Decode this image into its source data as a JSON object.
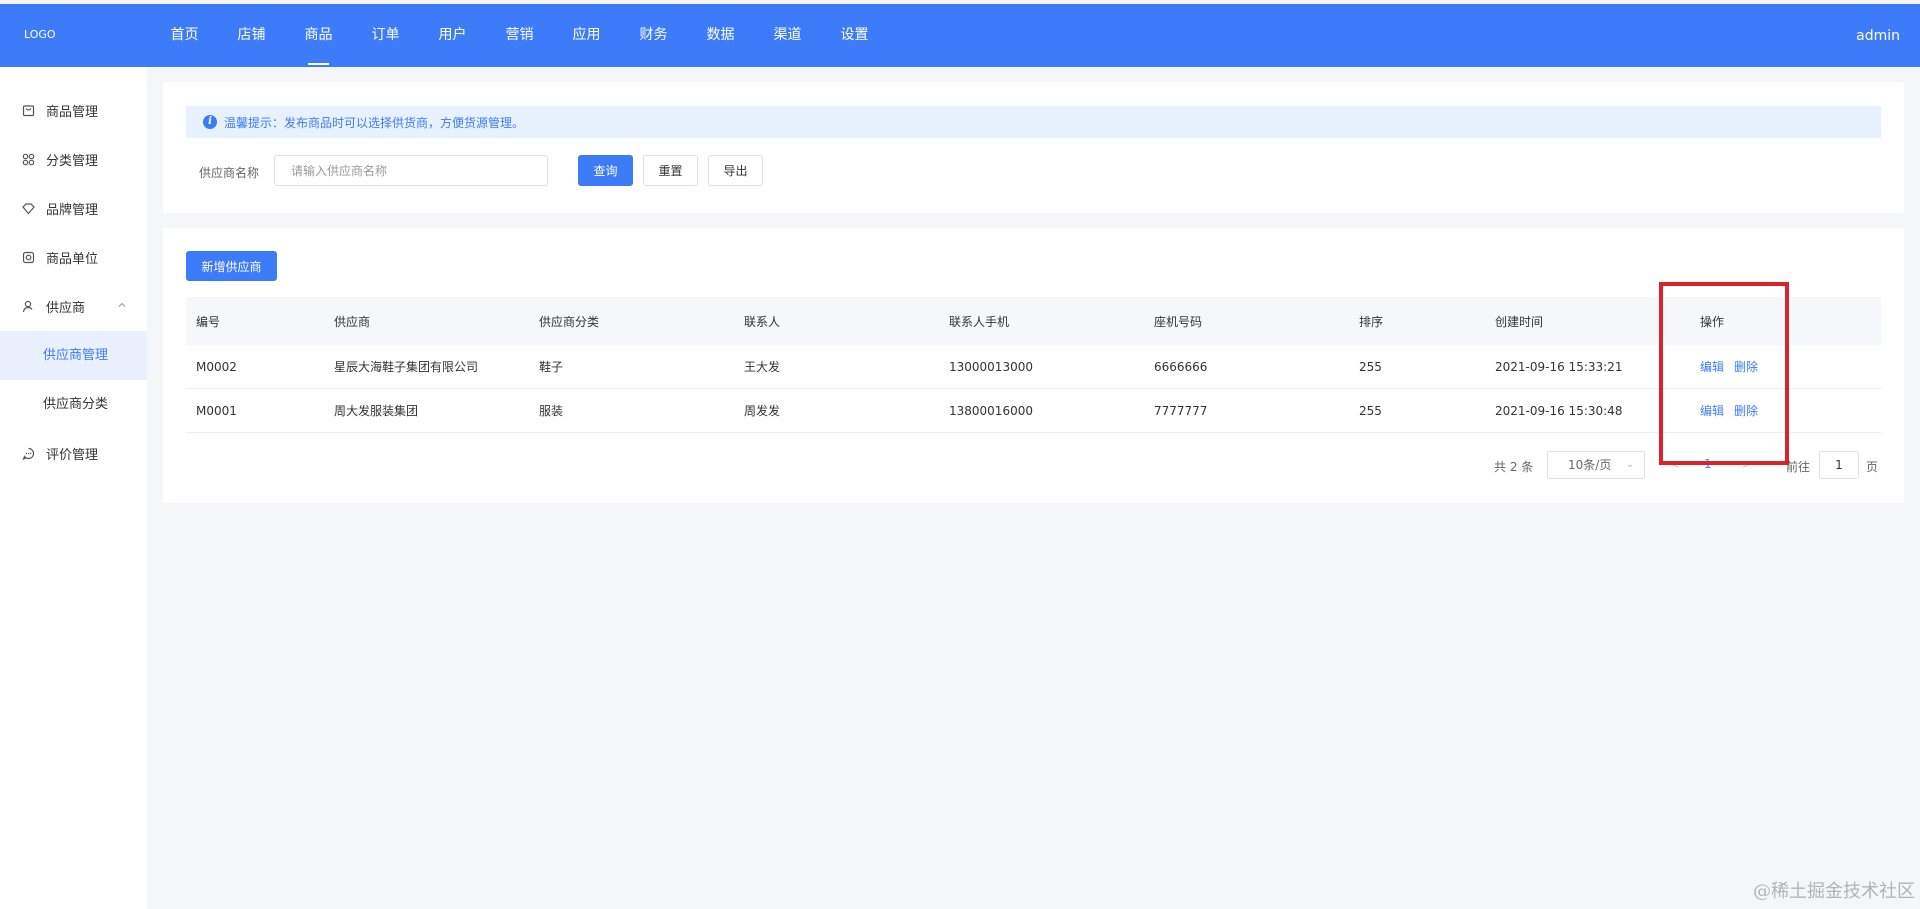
{
  "header": {
    "logo": "LOGO",
    "nav": [
      "首页",
      "店铺",
      "商品",
      "订单",
      "用户",
      "营销",
      "应用",
      "财务",
      "数据",
      "渠道",
      "设置"
    ],
    "active_nav": "商品",
    "user": "admin"
  },
  "sidebar": {
    "items": [
      {
        "label": "商品管理",
        "icon": "bag-icon"
      },
      {
        "label": "分类管理",
        "icon": "grid-icon"
      },
      {
        "label": "品牌管理",
        "icon": "diamond-icon"
      },
      {
        "label": "商品单位",
        "icon": "circle-icon"
      },
      {
        "label": "供应商",
        "icon": "user-icon"
      },
      {
        "label": "评价管理",
        "icon": "chat-icon"
      }
    ],
    "supplier_sub": [
      "供应商管理",
      "供应商分类"
    ],
    "active_sub": "供应商管理"
  },
  "filter": {
    "tip": "温馨提示：发布商品时可以选择供货商，方便货源管理。",
    "label": "供应商名称",
    "placeholder": "请输入供应商名称",
    "query": "查询",
    "reset": "重置",
    "export": "导出"
  },
  "list": {
    "add_button": "新增供应商",
    "columns": [
      "编号",
      "供应商",
      "供应商分类",
      "联系人",
      "联系人手机",
      "座机号码",
      "排序",
      "创建时间",
      "操作"
    ],
    "rows": [
      {
        "id": "M0002",
        "name": "星辰大海鞋子集团有限公司",
        "category": "鞋子",
        "contact": "王大发",
        "mobile": "13000013000",
        "phone": "6666666",
        "sort": "255",
        "created": "2021-09-16 15:33:21"
      },
      {
        "id": "M0001",
        "name": "周大发服装集团",
        "category": "服装",
        "contact": "周发发",
        "mobile": "13800016000",
        "phone": "7777777",
        "sort": "255",
        "created": "2021-09-16 15:30:48"
      }
    ],
    "edit": "编辑",
    "delete": "删除"
  },
  "pagination": {
    "total": "共 2 条",
    "page_size": "10条/页",
    "current": "1",
    "goto": "前往",
    "page_value": "1",
    "page_suffix": "页"
  },
  "watermark": "@稀土掘金技术社区",
  "colors": {
    "primary": "#3e7bf9",
    "highlight": "#d9232d"
  }
}
